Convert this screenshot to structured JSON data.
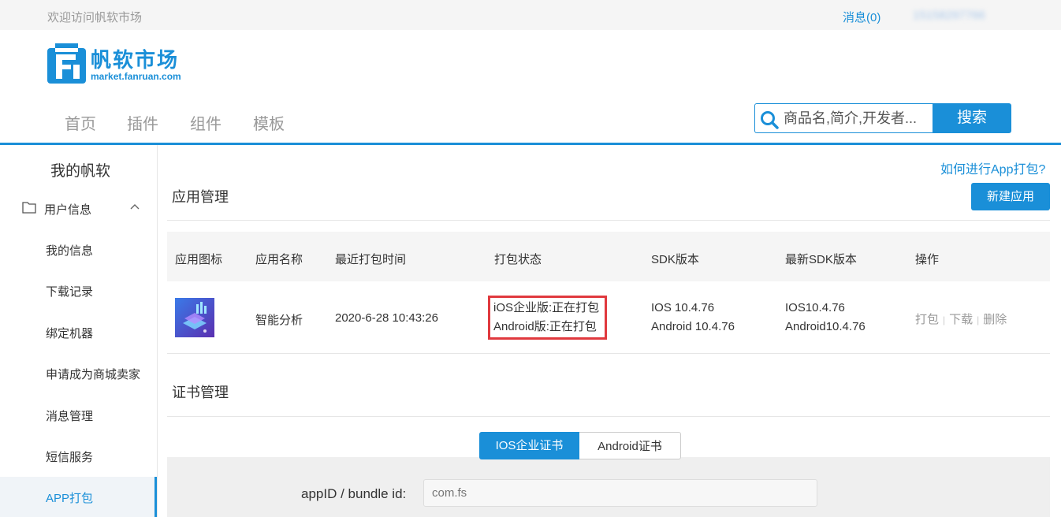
{
  "topbar": {
    "welcome": "欢迎访问帆软市场",
    "messages": "消息(0)",
    "user": "15158297766"
  },
  "brand": {
    "name": "帆软市场",
    "domain": "market.fanruan.com"
  },
  "nav": [
    {
      "label": "首页"
    },
    {
      "label": "插件"
    },
    {
      "label": "组件"
    },
    {
      "label": "模板"
    }
  ],
  "search": {
    "placeholder": "商品名,简介,开发者...",
    "button": "搜索"
  },
  "sidebar": {
    "title": "我的帆软",
    "group": "用户信息",
    "items": [
      {
        "label": "我的信息"
      },
      {
        "label": "下载记录"
      },
      {
        "label": "绑定机器"
      },
      {
        "label": "申请成为商城卖家"
      },
      {
        "label": "消息管理"
      },
      {
        "label": "短信服务"
      },
      {
        "label": "APP打包",
        "active": true
      }
    ]
  },
  "main": {
    "help_link": "如何进行App打包?",
    "app_section_title": "应用管理",
    "new_app_button": "新建应用",
    "table": {
      "headers": [
        "应用图标",
        "应用名称",
        "最近打包时间",
        "打包状态",
        "SDK版本",
        "最新SDK版本",
        "操作"
      ],
      "rows": [
        {
          "name": "智能分析",
          "time": "2020-6-28 10:43:26",
          "status_ios": "iOS企业版:正在打包",
          "status_android": "Android版:正在打包",
          "sdk_ios": "IOS 10.4.76",
          "sdk_android": "Android 10.4.76",
          "latest_ios": "IOS10.4.76",
          "latest_android": "Android10.4.76",
          "actions": [
            "打包",
            "下载",
            "删除"
          ]
        }
      ]
    },
    "cert_section_title": "证书管理",
    "cert_tabs": [
      "IOS企业证书",
      "Android证书"
    ],
    "cert_form": {
      "label": "appID / bundle id:",
      "placeholder": "com.fs"
    }
  },
  "colors": {
    "accent": "#1a8fd8",
    "highlight": "#e0393e"
  }
}
